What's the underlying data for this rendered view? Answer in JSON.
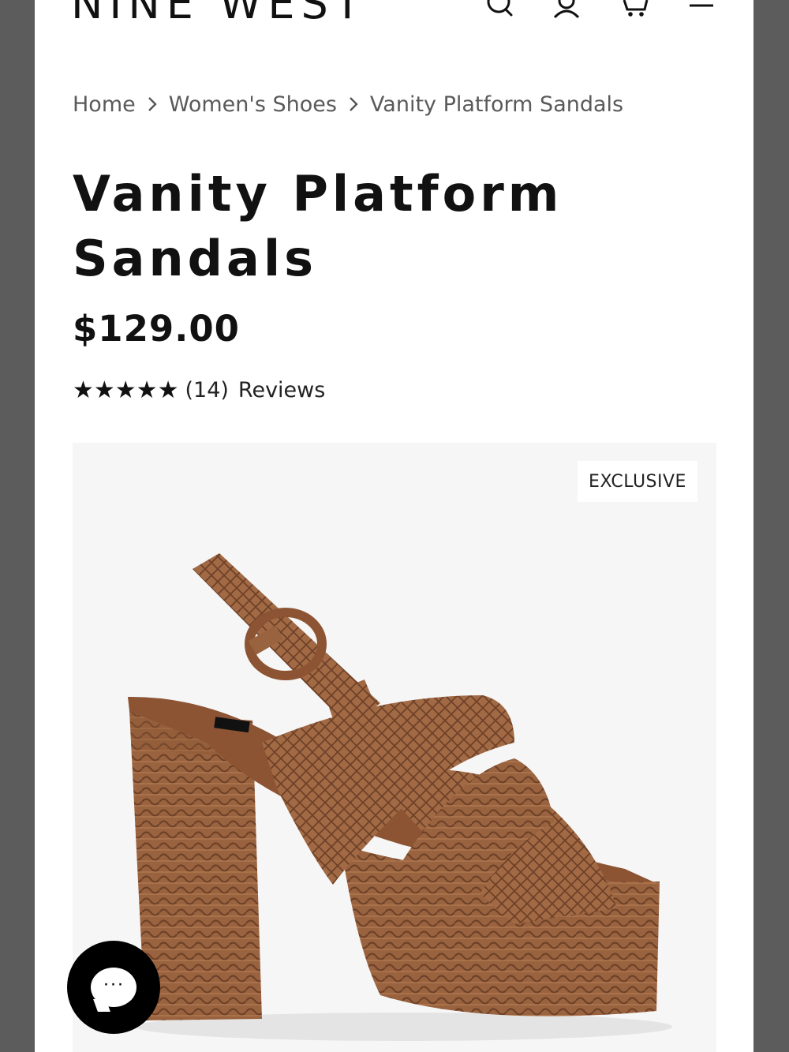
{
  "header": {
    "logo": "NINE WEST",
    "icons": [
      "search-icon",
      "account-icon",
      "cart-icon",
      "menu-icon"
    ]
  },
  "breadcrumb": {
    "items": [
      "Home",
      "Women's Shoes",
      "Vanity Platform Sandals"
    ]
  },
  "product": {
    "title": "Vanity Platform Sandals",
    "price": "$129.00",
    "rating": {
      "stars": "★★★★★",
      "value": 5,
      "count": "(14)",
      "label": "Reviews"
    },
    "badge": "EXCLUSIVE",
    "image_subject": "woven brown platform sandal"
  },
  "chat": {
    "icon": "chat-icon",
    "dots": "···"
  },
  "colors": {
    "text": "#111111",
    "breadcrumb": "#5a5a5a",
    "image_bg": "#f6f6f6",
    "sandal": "#9a633f",
    "backdrop": "#5c5c5c"
  }
}
